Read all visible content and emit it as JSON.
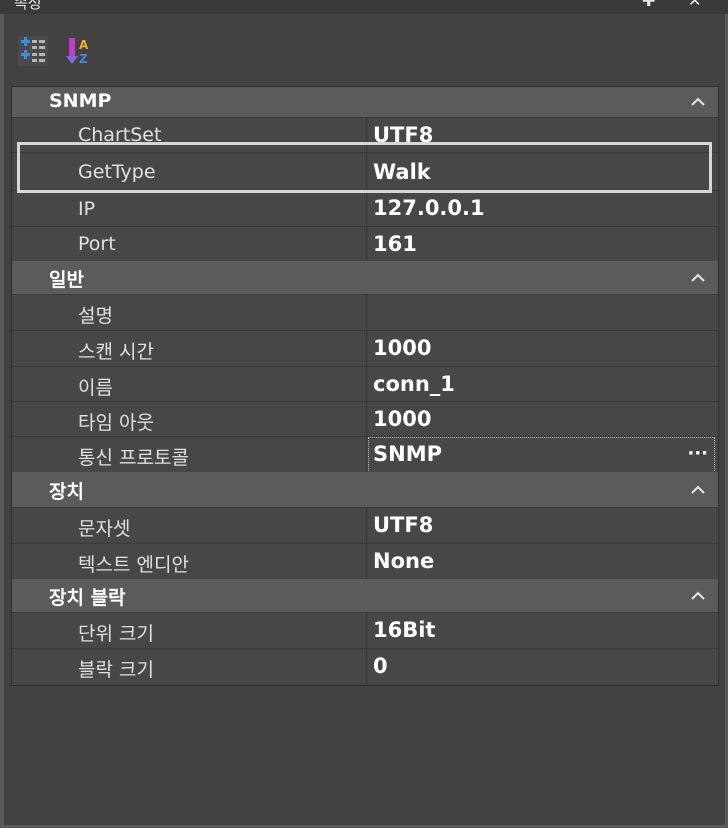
{
  "window": {
    "title": "속성",
    "pin_icon": "pin-icon",
    "close_icon": "close-icon"
  },
  "toolbar": {
    "categorized_icon": "categorized-view-icon",
    "alphabetical_icon": "alphabetical-sort-icon"
  },
  "categories": [
    {
      "name": "SNMP",
      "properties": [
        {
          "name": "ChartSet",
          "value": "UTF8"
        },
        {
          "name": "GetType",
          "value": "Walk"
        },
        {
          "name": "IP",
          "value": "127.0.0.1"
        },
        {
          "name": "Port",
          "value": "161"
        }
      ]
    },
    {
      "name": "일반",
      "properties": [
        {
          "name": "설명",
          "value": ""
        },
        {
          "name": "스캔 시간",
          "value": "1000"
        },
        {
          "name": "이름",
          "value": "conn_1"
        },
        {
          "name": "타임 아웃",
          "value": "1000"
        },
        {
          "name": "통신 프로토콜",
          "value": "SNMP",
          "button": "···"
        }
      ]
    },
    {
      "name": "장치",
      "properties": [
        {
          "name": "문자셋",
          "value": "UTF8"
        },
        {
          "name": "텍스트 엔디안",
          "value": "None"
        }
      ]
    },
    {
      "name": "장치 블락",
      "properties": [
        {
          "name": "단위 크기",
          "value": "16Bit"
        },
        {
          "name": "블락 크기",
          "value": "0"
        }
      ]
    }
  ],
  "colors": {
    "background": "#424242",
    "category_row": "#5b5b5b",
    "property_row": "#474747",
    "highlight": "#d7d7d7"
  }
}
